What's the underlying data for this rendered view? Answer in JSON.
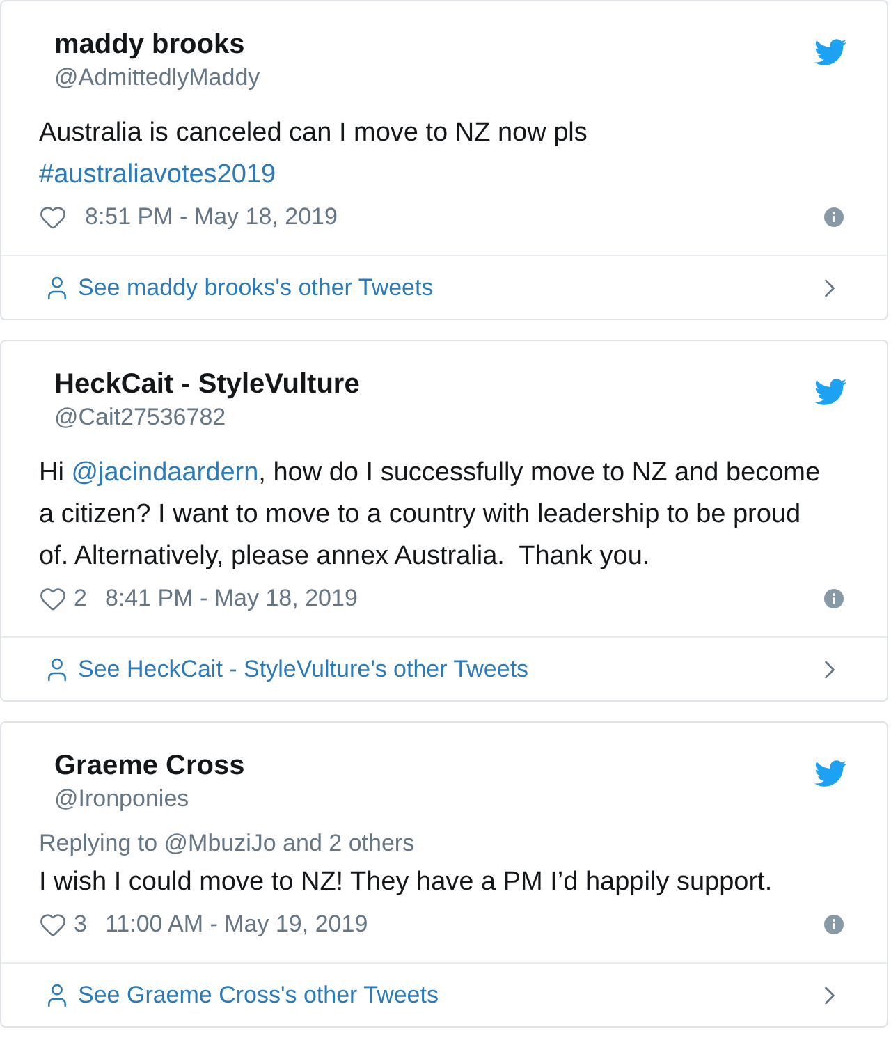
{
  "tweets": [
    {
      "name": "maddy brooks",
      "handle": "@AdmittedlyMaddy",
      "body_lines": [
        [
          {
            "kind": "plain",
            "text": "Australia is canceled can I move to NZ now pls"
          }
        ],
        [
          {
            "kind": "link",
            "text": "#australiavotes2019"
          }
        ]
      ],
      "timestamp": "8:51 PM - May 18, 2019",
      "other_tweets": "See maddy brooks's other Tweets"
    },
    {
      "name": "HeckCait - StyleVulture",
      "handle": "@Cait27536782",
      "body_lines": [
        [
          {
            "kind": "plain",
            "text": "Hi "
          },
          {
            "kind": "link",
            "text": "@jacindaardern"
          },
          {
            "kind": "plain",
            "text": ", how do I successfully move to NZ and become a citizen? I want to move to a country with leadership to be proud of. Alternatively, please annex Australia.  Thank you."
          }
        ]
      ],
      "likes": "2",
      "timestamp": "8:41 PM - May 18, 2019",
      "other_tweets": "See HeckCait - StyleVulture's other Tweets"
    },
    {
      "name": "Graeme Cross",
      "handle": "@Ironponies",
      "replying_to": "Replying to @MbuziJo and 2 others",
      "body_lines": [
        [
          {
            "kind": "plain",
            "text": "I wish I could move to NZ! They have a PM I’d happily support."
          }
        ]
      ],
      "likes": "3",
      "timestamp": "11:00 AM - May 19, 2019",
      "other_tweets": "See Graeme Cross's other Tweets"
    }
  ]
}
